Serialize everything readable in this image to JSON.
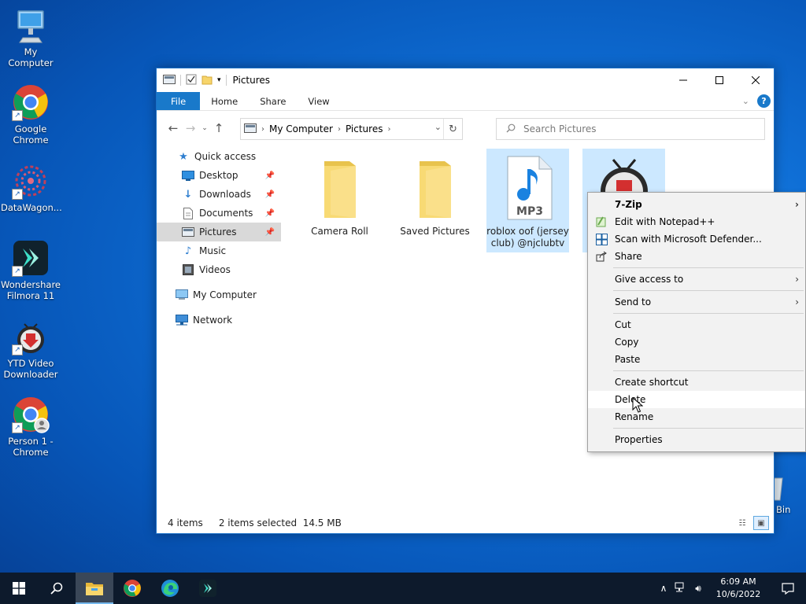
{
  "desktop": {
    "icons": [
      {
        "label": "My Computer"
      },
      {
        "label": "Google Chrome"
      },
      {
        "label": "DataWagon..."
      },
      {
        "label": "Wondershare Filmora 11"
      },
      {
        "label": "YTD Video Downloader"
      },
      {
        "label": "Person 1 - Chrome"
      }
    ],
    "recycle_bin_label": "Bin"
  },
  "window": {
    "title": "Pictures",
    "ribbon_tabs": [
      "File",
      "Home",
      "Share",
      "View"
    ],
    "address": {
      "crumbs": [
        "My Computer",
        "Pictures"
      ]
    },
    "search_placeholder": "Search Pictures",
    "sidebar": [
      {
        "label": "Quick access",
        "icon": "star-icon"
      },
      {
        "label": "Desktop",
        "icon": "desktop-icon",
        "pinned": true
      },
      {
        "label": "Downloads",
        "icon": "download-icon",
        "pinned": true
      },
      {
        "label": "Documents",
        "icon": "document-icon",
        "pinned": true
      },
      {
        "label": "Pictures",
        "icon": "pictures-icon",
        "pinned": true,
        "selected": true
      },
      {
        "label": "Music",
        "icon": "music-icon"
      },
      {
        "label": "Videos",
        "icon": "video-icon"
      },
      {
        "label": "My Computer",
        "icon": "computer-icon"
      },
      {
        "label": "Network",
        "icon": "network-icon"
      }
    ],
    "files": [
      {
        "name": "Camera Roll",
        "type": "folder",
        "selected": false
      },
      {
        "name": "Saved Pictures",
        "type": "folder",
        "selected": false
      },
      {
        "name": "roblox oof (jersey club) @njclubtv",
        "type": "mp3",
        "badge": "MP3",
        "selected": true
      },
      {
        "name": "",
        "type": "ytd",
        "selected": true
      }
    ],
    "status": {
      "items": "4 items",
      "selected": "2 items selected  14.5 MB"
    }
  },
  "context_menu": {
    "groups": [
      [
        {
          "label": "7-Zip",
          "bold": true,
          "submenu": true
        },
        {
          "label": "Edit with Notepad++",
          "icon": "notepad-icon"
        },
        {
          "label": "Scan with Microsoft Defender...",
          "icon": "defender-icon"
        },
        {
          "label": "Share",
          "icon": "share-icon"
        }
      ],
      [
        {
          "label": "Give access to",
          "submenu": true
        }
      ],
      [
        {
          "label": "Send to",
          "submenu": true
        }
      ],
      [
        {
          "label": "Cut"
        },
        {
          "label": "Copy"
        },
        {
          "label": "Paste"
        }
      ],
      [
        {
          "label": "Create shortcut"
        },
        {
          "label": "Delete",
          "hover": true
        },
        {
          "label": "Rename"
        }
      ],
      [
        {
          "label": "Properties"
        }
      ]
    ]
  },
  "taskbar": {
    "time": "6:09 AM",
    "date": "10/6/2022"
  },
  "colors": {
    "accent": "#1979ca",
    "selection": "#cce8ff",
    "taskbar": "#0d1a2c"
  }
}
